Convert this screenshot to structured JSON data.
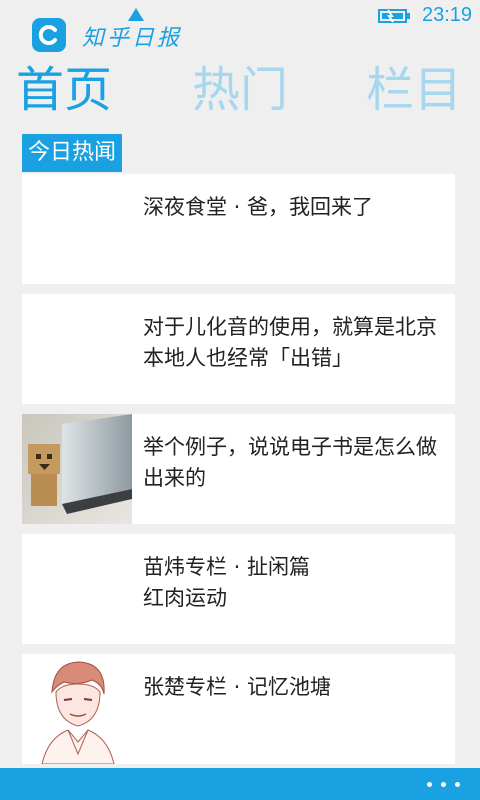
{
  "status_bar": {
    "time": "23:19",
    "battery_icon": "battery-charging-icon"
  },
  "app": {
    "name": "知乎日报",
    "logo_icon": "zhihu-daily-logo-icon"
  },
  "pivot": [
    {
      "label": "首页",
      "active": true
    },
    {
      "label": "热门",
      "active": false
    },
    {
      "label": "栏目",
      "active": false
    }
  ],
  "section": {
    "label": "今日热闻"
  },
  "stories": [
    {
      "title": "深夜食堂 · 爸，我回来了",
      "thumbnail": "none"
    },
    {
      "title": "对于儿化音的使用，就算是北京本地人也经常「出错」",
      "thumbnail": "none"
    },
    {
      "title": "举个例子，说说电子书是怎么做出来的",
      "thumbnail": "danbo-figure-on-ebook-photo"
    },
    {
      "title": "苗炜专栏 · 扯闲篇\n红肉运动",
      "thumbnail": "none"
    },
    {
      "title": "张楚专栏 · 记忆池塘",
      "thumbnail": "portrait-sketch"
    }
  ],
  "app_bar": {
    "more_icon": "more-dots-icon"
  },
  "colors": {
    "accent": "#1aa1e1",
    "inactive_pivot": "#a7d7ef",
    "background": "#efefef"
  }
}
